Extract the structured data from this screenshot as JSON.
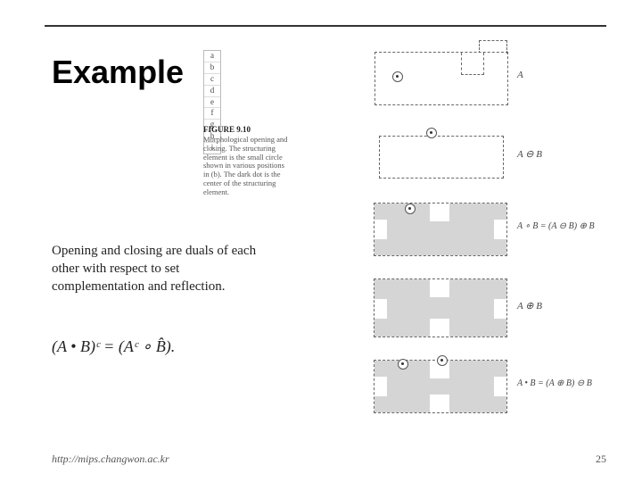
{
  "title": "Example",
  "body_text": "Opening and closing are duals of each other with respect to set complementation and reflection.",
  "equation": "(A • B)ᶜ = (Aᶜ ∘ B̂).",
  "panel_key": [
    "a",
    "b",
    "c",
    "d",
    "e",
    "f",
    "g",
    "h",
    "i"
  ],
  "figure": {
    "number_label": "FIGURE 9.10",
    "caption": "Morphological opening and closing. The structuring element is the small circle shown in various positions in (b). The dark dot is the center of the structuring element."
  },
  "rows": {
    "a": "A",
    "b": "A ⊖ B",
    "c": "A ∘ B = (A ⊖ B) ⊕ B",
    "d": "A ⊕ B",
    "e": "A • B = (A ⊕ B) ⊖ B"
  },
  "footer": {
    "url": "http://mips.changwon.ac.kr",
    "page": "25"
  }
}
